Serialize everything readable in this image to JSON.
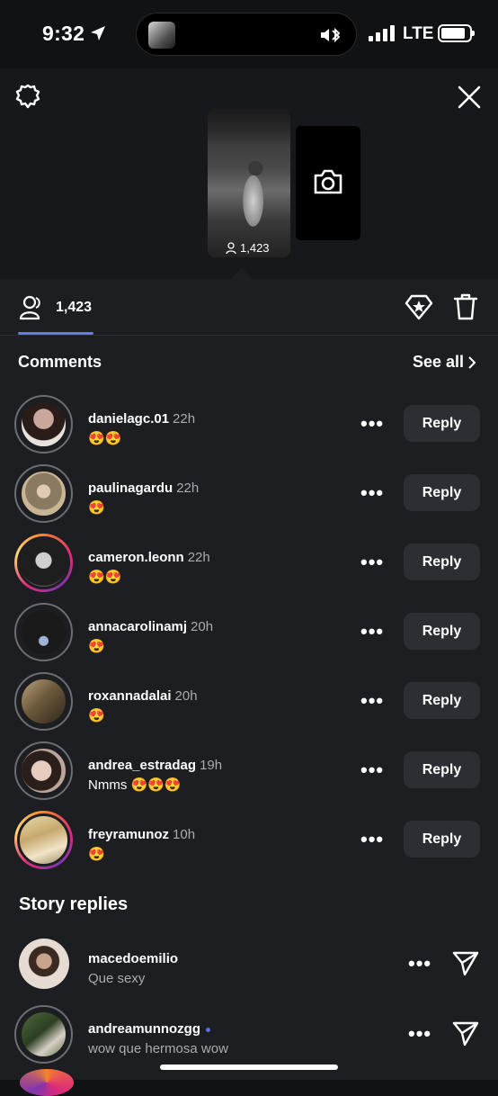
{
  "status_bar": {
    "time": "9:32",
    "network": "LTE"
  },
  "story": {
    "viewer_count": "1,423"
  },
  "tabs": {
    "viewers_count": "1,423"
  },
  "comments_section": {
    "title": "Comments",
    "see_all": "See all",
    "reply_label": "Reply",
    "items": [
      {
        "username": "danielagc.01",
        "time": "22h",
        "text": "😍😍"
      },
      {
        "username": "paulinagardu",
        "time": "22h",
        "text": "😍"
      },
      {
        "username": "cameron.leonn",
        "time": "22h",
        "text": "😍😍"
      },
      {
        "username": "annacarolinamj",
        "time": "20h",
        "text": "😍"
      },
      {
        "username": "roxannadalai",
        "time": "20h",
        "text": "😍"
      },
      {
        "username": "andrea_estradag",
        "time": "19h",
        "text": "Nmms 😍😍😍"
      },
      {
        "username": "freyramunoz",
        "time": "10h",
        "text": "😍"
      }
    ]
  },
  "story_replies_section": {
    "title": "Story replies",
    "items": [
      {
        "username": "macedoemilio",
        "text": "Que sexy"
      },
      {
        "username": "andreamunnozgg",
        "text": "wow que hermosa wow"
      }
    ]
  },
  "icons": {
    "settings": "settings-icon",
    "close": "close-icon",
    "camera": "camera-icon",
    "viewers": "viewers-icon",
    "highlight": "highlight-diamond-icon",
    "delete": "trash-icon",
    "more": "more-dots-icon",
    "send": "send-icon"
  },
  "colors": {
    "background": "#1c1e22",
    "accent_underline": "#6a78e8",
    "button_bg": "#2c2e33",
    "secondary_text": "#a8abb1"
  }
}
